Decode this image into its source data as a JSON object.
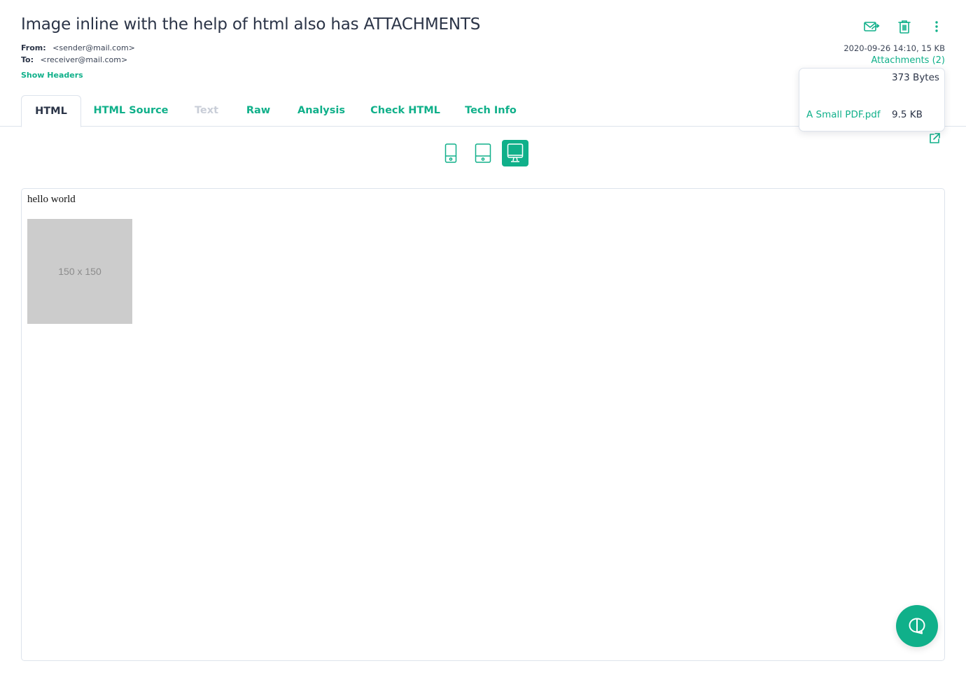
{
  "email": {
    "subject": "Image inline with the help of html also has ATTACHMENTS",
    "from_label": "From:",
    "from_value": "<sender@mail.com>",
    "to_label": "To:",
    "to_value": "<receiver@mail.com>",
    "show_headers": "Show Headers",
    "date_size": "2020-09-26 14:10, 15 KB",
    "attachments_link": "Attachments (2)"
  },
  "actions": [
    {
      "name": "forward",
      "icon": "forward-mail-icon"
    },
    {
      "name": "delete",
      "icon": "trash-icon"
    },
    {
      "name": "more",
      "icon": "more-vertical-icon"
    }
  ],
  "attachments": [
    {
      "name": "",
      "size": "373 Bytes"
    },
    {
      "name": "A Small PDF.pdf",
      "size": "9.5 KB"
    }
  ],
  "tabs": [
    {
      "label": "HTML",
      "state": "active"
    },
    {
      "label": "HTML Source",
      "state": "normal"
    },
    {
      "label": "Text",
      "state": "disabled"
    },
    {
      "label": "Raw",
      "state": "normal"
    },
    {
      "label": "Analysis",
      "state": "normal"
    },
    {
      "label": "Check HTML",
      "state": "normal"
    },
    {
      "label": "Tech Info",
      "state": "normal"
    }
  ],
  "device_modes": [
    {
      "name": "mobile",
      "active": false
    },
    {
      "name": "tablet",
      "active": false
    },
    {
      "name": "desktop",
      "active": true
    }
  ],
  "preview": {
    "body_text": "hello world",
    "image_placeholder": "150 x 150"
  },
  "colors": {
    "accent": "#10b08a",
    "text": "#2b3447",
    "disabled": "#c9ced8",
    "border": "#dde3ec"
  }
}
